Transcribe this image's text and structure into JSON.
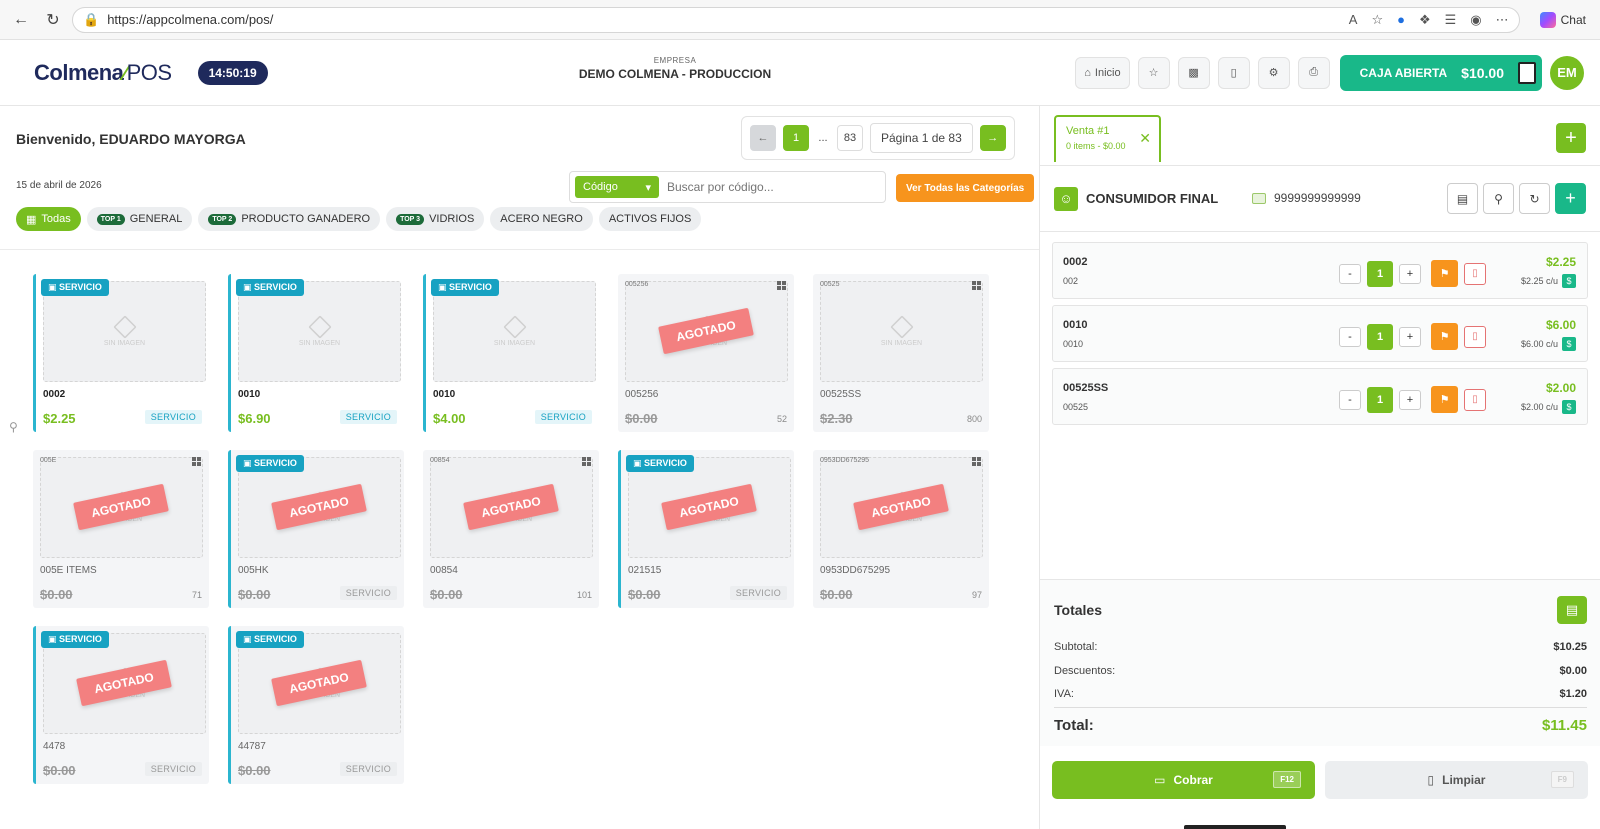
{
  "browser": {
    "url": "https://appcolmena.com/pos/",
    "chat_label": "Chat"
  },
  "header": {
    "logo_main": "Colmena",
    "logo_suffix": "POS",
    "clock": "14:50:19",
    "empresa_label": "EMPRESA",
    "empresa_name": "DEMO COLMENA - PRODUCCION",
    "inicio_label": "Inicio",
    "caja_label": "CAJA ABIERTA",
    "caja_amount": "$10.00",
    "avatar_initials": "EM"
  },
  "left": {
    "welcome": "Bienvenido, EDUARDO MAYORGA",
    "date": "15 de abril de 2026",
    "pager": {
      "current": "1",
      "ellipsis": "...",
      "last": "83",
      "info": "Página 1 de 83"
    },
    "search": {
      "mode": "Código",
      "placeholder": "Buscar por código..."
    },
    "ver_todas": "Ver Todas las Categorías",
    "categories": [
      {
        "label": "Todas",
        "badge": ""
      },
      {
        "label": "GENERAL",
        "badge": "TOP 1"
      },
      {
        "label": "PRODUCTO GANADERO",
        "badge": "TOP 2"
      },
      {
        "label": "VIDRIOS",
        "badge": "TOP 3"
      },
      {
        "label": "ACERO NEGRO",
        "badge": ""
      },
      {
        "label": "ACTIVOS FIJOS",
        "badge": ""
      }
    ],
    "sin_imagen": "SIN IMAGEN",
    "servicio_badge": "SERVICIO",
    "agotado": "AGOTADO",
    "products": [
      {
        "code": "",
        "name": "0002",
        "price": "$2.25",
        "tag": "SERVICIO",
        "servicio": true,
        "agotado": false
      },
      {
        "code": "",
        "name": "0010",
        "price": "$6.90",
        "tag": "SERVICIO",
        "servicio": true,
        "agotado": false
      },
      {
        "code": "",
        "name": "0010",
        "price": "$4.00",
        "tag": "SERVICIO",
        "servicio": true,
        "agotado": false
      },
      {
        "code": "005256",
        "name": "005256",
        "price": "$0.00",
        "tag": "52",
        "servicio": false,
        "agotado": true
      },
      {
        "code": "00525",
        "name": "00525SS",
        "price": "$2.30",
        "tag": "800",
        "servicio": false,
        "agotado": false
      },
      {
        "code": "005E",
        "name": "005E ITEMS",
        "price": "$0.00",
        "tag": "71",
        "servicio": false,
        "agotado": true
      },
      {
        "code": "",
        "name": "005HK",
        "price": "$0.00",
        "tag": "SERVICIO",
        "servicio": true,
        "agotado": true
      },
      {
        "code": "00854",
        "name": "00854",
        "price": "$0.00",
        "tag": "101",
        "servicio": false,
        "agotado": true
      },
      {
        "code": "",
        "name": "021515",
        "price": "$0.00",
        "tag": "SERVICIO",
        "servicio": true,
        "agotado": true
      },
      {
        "code": "0953DD675295",
        "name": "0953DD675295",
        "price": "$0.00",
        "tag": "97",
        "servicio": false,
        "agotado": true
      },
      {
        "code": "",
        "name": "4478",
        "price": "$0.00",
        "tag": "SERVICIO",
        "servicio": true,
        "agotado": true
      },
      {
        "code": "",
        "name": "44787",
        "price": "$0.00",
        "tag": "SERVICIO",
        "servicio": true,
        "agotado": true
      }
    ]
  },
  "right": {
    "tab": {
      "title": "Venta #1",
      "sub": "0 items - $0.00"
    },
    "client": {
      "name": "CONSUMIDOR FINAL",
      "id": "9999999999999"
    },
    "items": [
      {
        "code": "0002",
        "sub": "002",
        "qty": "1",
        "price": "$2.25",
        "unit": "$2.25 c/u"
      },
      {
        "code": "0010",
        "sub": "0010",
        "qty": "1",
        "price": "$6.00",
        "unit": "$6.00 c/u"
      },
      {
        "code": "00525SS",
        "sub": "00525",
        "qty": "1",
        "price": "$2.00",
        "unit": "$2.00 c/u"
      }
    ],
    "totals": {
      "title": "Totales",
      "subtotal_label": "Subtotal:",
      "subtotal": "$10.25",
      "descuentos_label": "Descuentos:",
      "descuentos": "$0.00",
      "iva_label": "IVA:",
      "iva": "$1.20",
      "total_label": "Total:",
      "total": "$11.45"
    },
    "cobrar": "Cobrar",
    "cobrar_key": "F12",
    "limpiar": "Limpiar",
    "limpiar_key": "F9"
  },
  "colors": {
    "brand_green": "#78be20",
    "navy": "#1f2a5c",
    "teal": "#19b889",
    "orange": "#f7941d",
    "agotado_red": "#f38080",
    "servicio_blue": "#17a2c2"
  }
}
